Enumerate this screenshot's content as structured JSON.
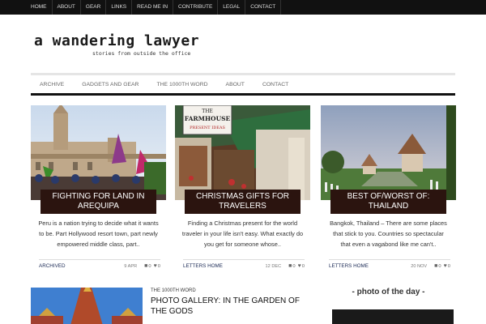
{
  "top_nav": [
    "HOME",
    "ABOUT",
    "GEAR",
    "LINKS",
    "READ ME IN",
    "CONTRIBUTE",
    "LEGAL",
    "CONTACT"
  ],
  "site": {
    "title": "a wandering lawyer",
    "tagline": "stories from outside the office"
  },
  "main_nav": [
    "ARCHIVE",
    "GADGETS AND GEAR",
    "THE 1000TH WORD",
    "ABOUT",
    "CONTACT"
  ],
  "cards": [
    {
      "title": "FIGHTING FOR LAND IN AREQUIPA",
      "excerpt": "Peru is a nation trying to decide what it wants to be. Part Hollywood resort town, part newly empowered middle class, part..",
      "category": "ARCHIVED",
      "date": "9 APR",
      "comments": "0",
      "likes": "0"
    },
    {
      "title": "CHRISTMAS GIFTS FOR TRAVELERS",
      "excerpt": "Finding a Christmas present for the world traveler in your life isn't easy.  What exactly do you get for someone whose..",
      "category": "LETTERS HOME",
      "date": "12 DEC",
      "comments": "0",
      "likes": "0"
    },
    {
      "title": "BEST OF/WORST OF: THAILAND",
      "excerpt": "Bangkok, Thailand – There are some places that stick to you. Countries so spectacular that even a vagabond like me can't..",
      "category": "LETTERS HOME",
      "date": "20 NOV",
      "comments": "0",
      "likes": "0"
    }
  ],
  "shop_sign": {
    "line1": "THE",
    "line2": "FARMHOUSE",
    "line3": "PRESENT IDEAS"
  },
  "bottom_post": {
    "category": "THE 1000TH WORD",
    "title": "PHOTO GALLERY: IN THE GARDEN OF THE GODS"
  },
  "sidebar": {
    "photo_heading": "- photo of the day -"
  },
  "icons": {
    "comment": "comment-icon",
    "like": "heart-icon"
  },
  "colors": {
    "title_box": "#2b140f",
    "top_bar": "#111111",
    "category": "#1b2a55"
  }
}
